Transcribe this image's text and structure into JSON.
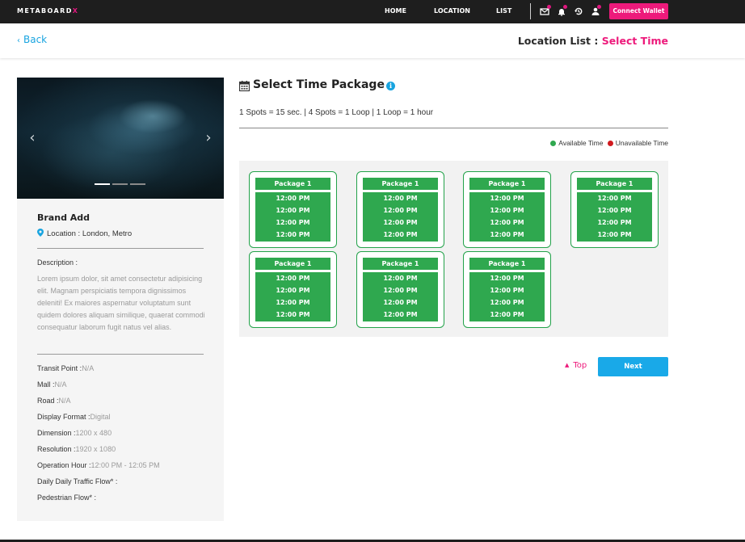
{
  "nav": {
    "logo_main": "METABOARD",
    "logo_accent": "X",
    "links": [
      "HOME",
      "LOCATION",
      "LIST"
    ],
    "connect_wallet": "Connect Wallet",
    "icons": [
      "mail-icon",
      "bell-icon",
      "history-icon",
      "user-icon"
    ],
    "accent_color": "#ed1a7b"
  },
  "subheader": {
    "back_label": "Back",
    "crumb_main": "Location List :",
    "crumb_active": "Select Time"
  },
  "listing": {
    "brand": "Brand Add",
    "location": "Location : London, Metro",
    "description_label": "Description :",
    "description": "Lorem ipsum dolor, sit amet consectetur adipisicing elit. Magnam perspiciatis tempora dignissimos deleniti! Ex maiores aspernatur voluptatum sunt quidem dolores aliquam similique, quaerat commodi consequatur laborum fugit natus vel alias.",
    "specs": [
      {
        "label": "Transit Point :",
        "value": "N/A"
      },
      {
        "label": "Mall :",
        "value": "N/A"
      },
      {
        "label": "Road :",
        "value": "N/A"
      },
      {
        "label": "Display Format :",
        "value": "Digital"
      },
      {
        "label": "Dimension :",
        "value": "1200 x 480"
      },
      {
        "label": "Resolution :",
        "value": "1920 x 1080"
      },
      {
        "label": "Operation Hour :",
        "value": "12:00 PM - 12:05 PM"
      },
      {
        "label": "Daily Daily Traffic Flow* :",
        "value": ""
      },
      {
        "label": "Pedestrian Flow* :",
        "value": ""
      }
    ]
  },
  "packages_section": {
    "title": "Select Time Package",
    "spots_info": "1 Spots = 15 sec. | 4 Spots = 1 Loop | 1 Loop = 1 hour",
    "legend_available": "Available Time",
    "legend_unavailable": "Unavailable Time",
    "available_color": "#2fa84f",
    "unavailable_color": "#d0191e",
    "packages": [
      {
        "name": "Package 1",
        "slots": [
          "12:00 PM",
          "12:00 PM",
          "12:00 PM",
          "12:00 PM"
        ]
      },
      {
        "name": "Package 1",
        "slots": [
          "12:00 PM",
          "12:00 PM",
          "12:00 PM",
          "12:00 PM"
        ]
      },
      {
        "name": "Package 1",
        "slots": [
          "12:00 PM",
          "12:00 PM",
          "12:00 PM",
          "12:00 PM"
        ]
      },
      {
        "name": "Package 1",
        "slots": [
          "12:00 PM",
          "12:00 PM",
          "12:00 PM",
          "12:00 PM"
        ]
      },
      {
        "name": "Package 1",
        "slots": [
          "12:00 PM",
          "12:00 PM",
          "12:00 PM",
          "12:00 PM"
        ]
      },
      {
        "name": "Package 1",
        "slots": [
          "12:00 PM",
          "12:00 PM",
          "12:00 PM",
          "12:00 PM"
        ]
      },
      {
        "name": "Package 1",
        "slots": [
          "12:00 PM",
          "12:00 PM",
          "12:00 PM",
          "12:00 PM"
        ]
      }
    ]
  },
  "footer_actions": {
    "top_label": "Top",
    "next_label": "Next"
  }
}
